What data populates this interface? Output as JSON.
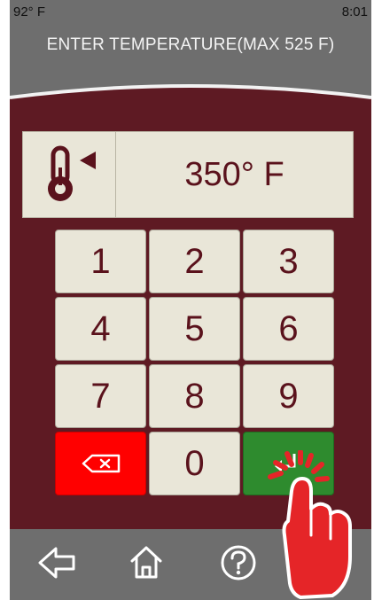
{
  "status": {
    "outside_temp": "92° F",
    "time": "8:01"
  },
  "header": {
    "title": "ENTER TEMPERATURE(MAX 525 F)"
  },
  "display": {
    "value": "350° F",
    "icon": "thermometer-icon"
  },
  "keypad": {
    "keys": [
      "1",
      "2",
      "3",
      "4",
      "5",
      "6",
      "7",
      "8",
      "9"
    ],
    "zero": "0",
    "delete_icon": "backspace-icon",
    "enter_icon": "enter-icon"
  },
  "nav": {
    "icons": [
      "back-arrow-icon",
      "home-icon",
      "help-icon"
    ]
  },
  "colors": {
    "header_bg": "#6e6e6e",
    "body_bg": "#5e1a23",
    "key_bg": "#e9e6d8",
    "key_text": "#5a121c",
    "delete_bg": "#ff0000",
    "enter_bg": "#2e8b2e",
    "hand": "#e52528"
  }
}
